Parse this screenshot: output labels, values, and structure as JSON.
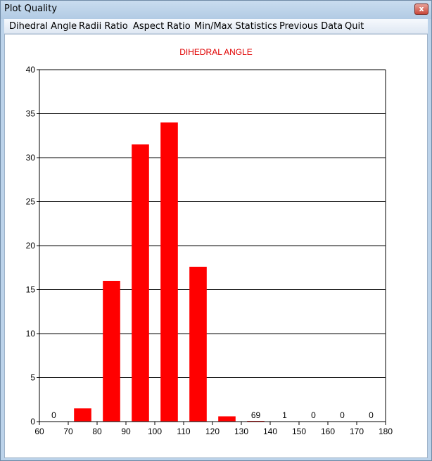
{
  "window": {
    "title": "Plot Quality",
    "close_label": "x"
  },
  "menu": {
    "items": [
      "Dihedral Angle",
      "Radii Ratio",
      "Aspect Ratio",
      "Min/Max Statistics",
      "Previous Data",
      "Quit"
    ]
  },
  "colors": {
    "bar": "#ff0000",
    "title": "#e00000"
  },
  "chart_data": {
    "type": "bar",
    "title": "DIHEDRAL ANGLE",
    "xlabel": "",
    "ylabel": "",
    "xlim": [
      60,
      180
    ],
    "ylim": [
      0,
      40
    ],
    "xticks": [
      60,
      70,
      80,
      90,
      100,
      110,
      120,
      130,
      140,
      150,
      160,
      170,
      180
    ],
    "yticks": [
      0,
      5,
      10,
      15,
      20,
      25,
      30,
      35,
      40
    ],
    "grid": "horizontal",
    "bins": [
      {
        "start": 60,
        "end": 70,
        "value": 0,
        "label": "0"
      },
      {
        "start": 70,
        "end": 80,
        "value": 1.5,
        "label": ""
      },
      {
        "start": 80,
        "end": 90,
        "value": 16,
        "label": ""
      },
      {
        "start": 90,
        "end": 100,
        "value": 31.5,
        "label": ""
      },
      {
        "start": 100,
        "end": 110,
        "value": 34,
        "label": ""
      },
      {
        "start": 110,
        "end": 120,
        "value": 17.6,
        "label": ""
      },
      {
        "start": 120,
        "end": 130,
        "value": 0.6,
        "label": ""
      },
      {
        "start": 130,
        "end": 140,
        "value": 0.05,
        "label": "69"
      },
      {
        "start": 140,
        "end": 150,
        "value": 0,
        "label": "1"
      },
      {
        "start": 150,
        "end": 160,
        "value": 0,
        "label": "0"
      },
      {
        "start": 160,
        "end": 170,
        "value": 0,
        "label": "0"
      },
      {
        "start": 170,
        "end": 180,
        "value": 0,
        "label": "0"
      }
    ]
  }
}
